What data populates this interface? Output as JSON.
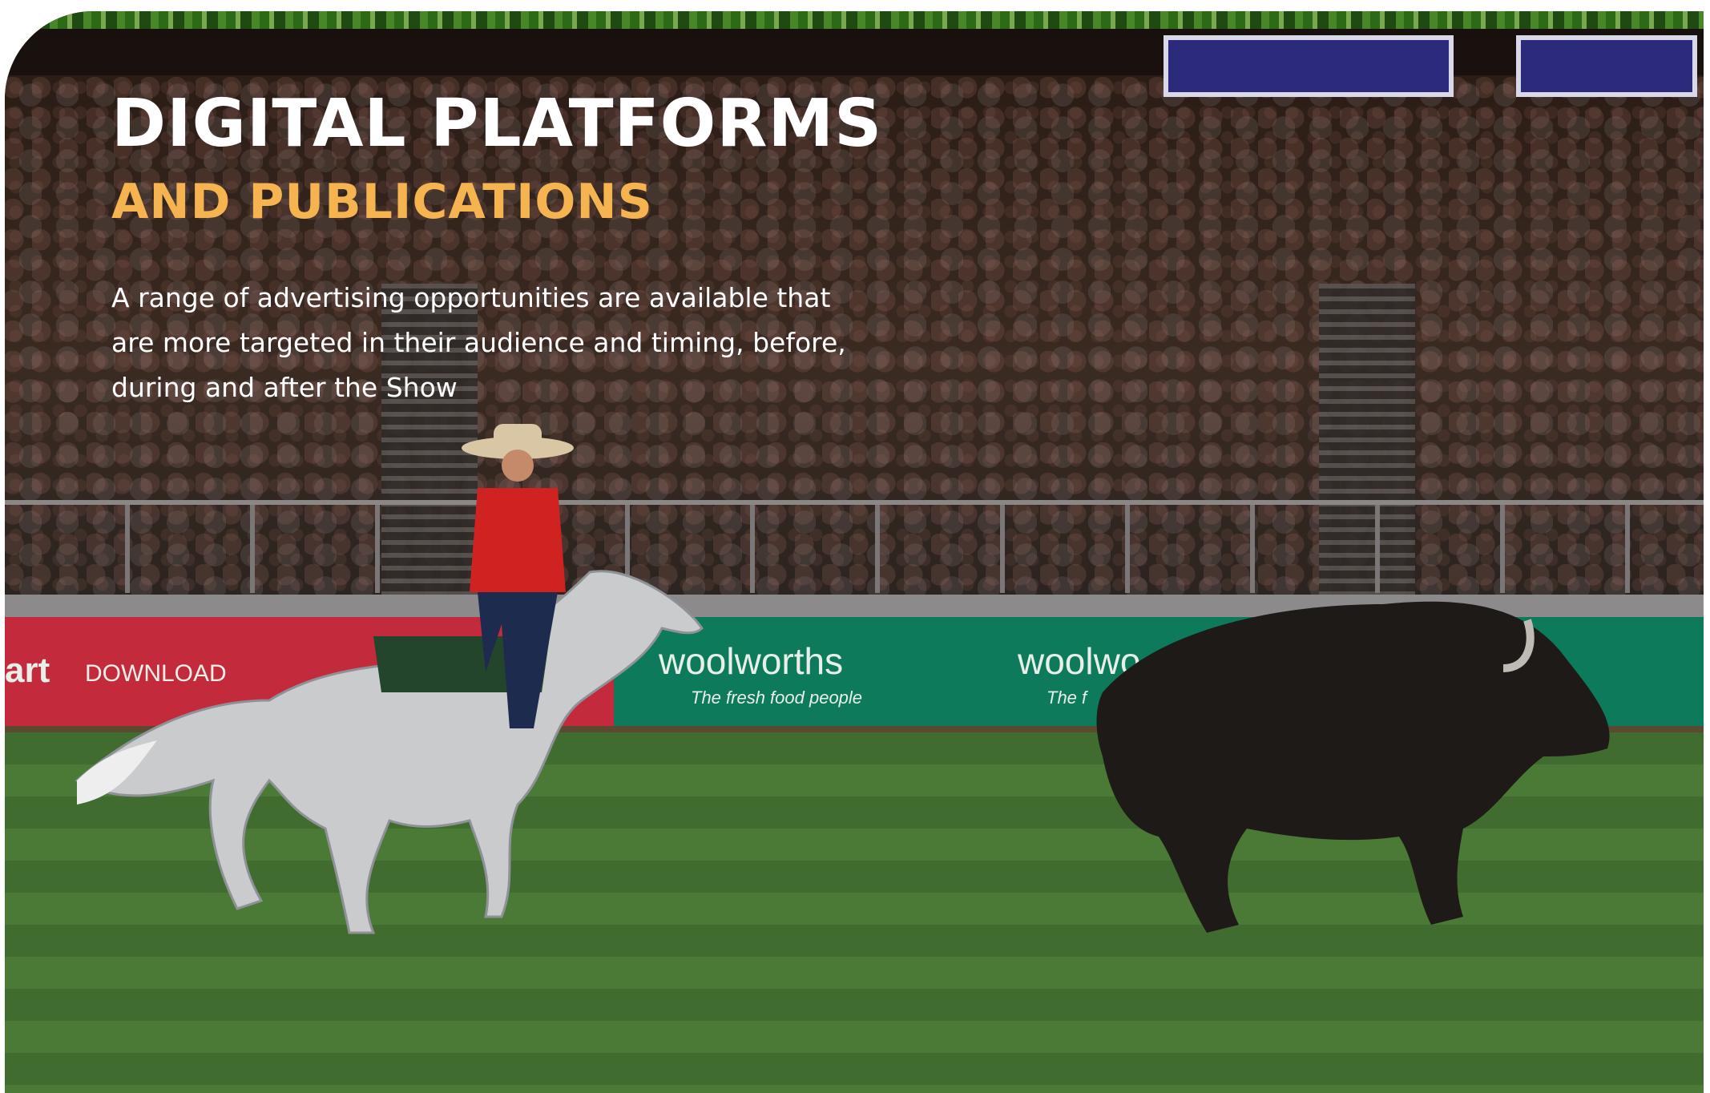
{
  "page": {
    "title_line1": "DIGITAL PLATFORMS",
    "title_line2": "AND PUBLICATIONS",
    "body": "A range of advertising opportunities are available that are more targeted in their audience and timing, before, during and after the Show"
  },
  "photo": {
    "banner_texts": [
      "art",
      "DOWNLOAD",
      "woolworths",
      "The fresh food people",
      "woolwo",
      "The f"
    ],
    "description_icons": [
      "horse-icon",
      "rider-icon",
      "bison-icon"
    ]
  },
  "colors": {
    "heading_white": "#ffffff",
    "heading_gold": "#f6b451",
    "banner_green": "#0d7a5c",
    "banner_red": "#c32a3c"
  }
}
